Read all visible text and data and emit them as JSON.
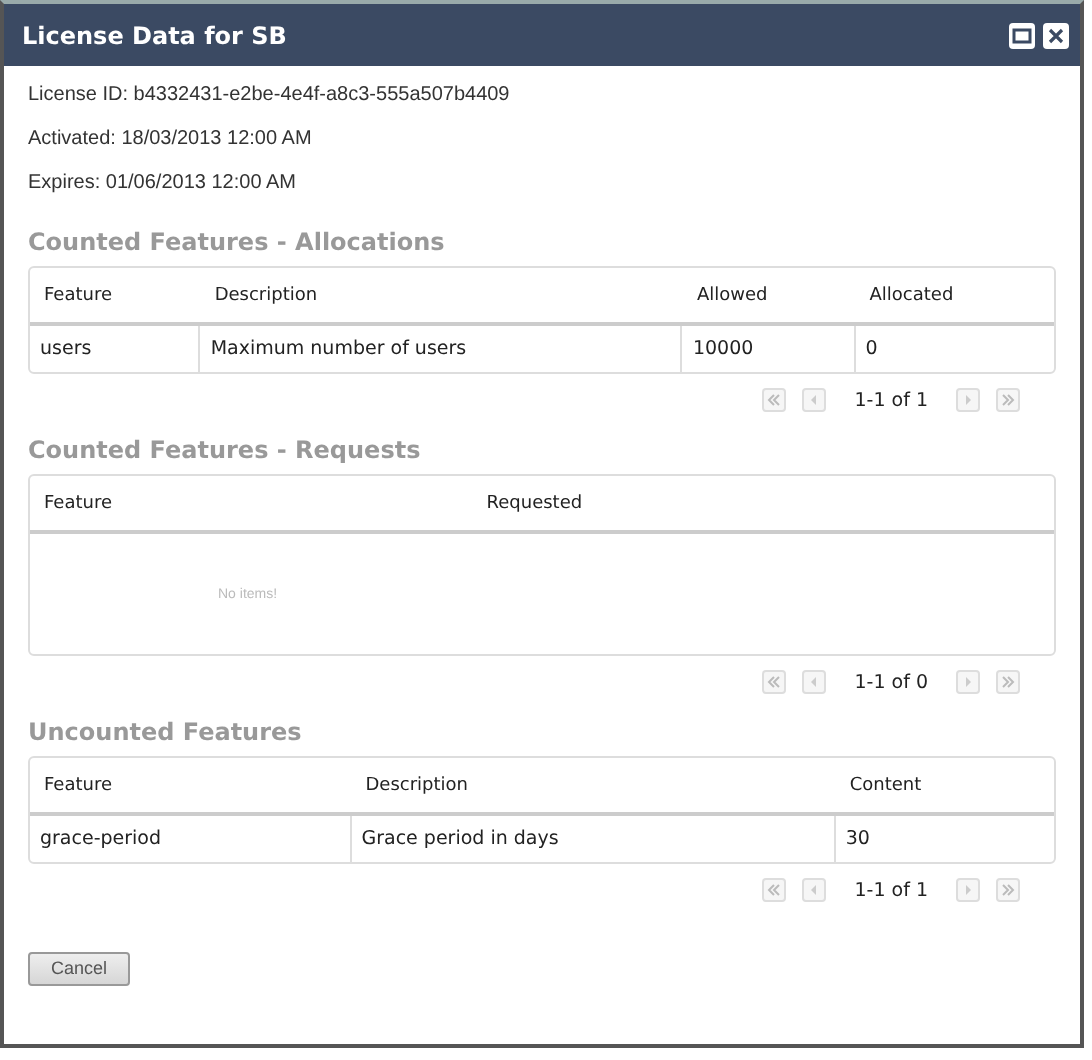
{
  "window": {
    "title": "License Data for SB"
  },
  "details": [
    "License ID: b4332431-e2be-4e4f-a8c3-555a507b4409",
    "Activated: 18/03/2013 12:00 AM",
    "Expires: 01/06/2013 12:00 AM"
  ],
  "sections": [
    {
      "heading": "Counted Features - Allocations",
      "columns": [
        "Feature",
        "Description",
        "Allowed",
        "Allocated"
      ],
      "rows": [
        [
          "users",
          "Maximum number of users",
          "10000",
          "0"
        ]
      ],
      "pager": {
        "range": "1-1 of 1"
      }
    },
    {
      "heading": "Counted Features - Requests",
      "columns": [
        "Feature",
        "Requested"
      ],
      "empty_text": "No items!",
      "pager": {
        "range": "1-1 of 0"
      }
    },
    {
      "heading": "Uncounted Features",
      "columns": [
        "Feature",
        "Description",
        "Content"
      ],
      "rows": [
        [
          "grace-period",
          "Grace period in days",
          "30"
        ]
      ],
      "pager": {
        "range": "1-1 of 1"
      }
    }
  ],
  "buttons": [
    {
      "label": "Cancel"
    }
  ]
}
